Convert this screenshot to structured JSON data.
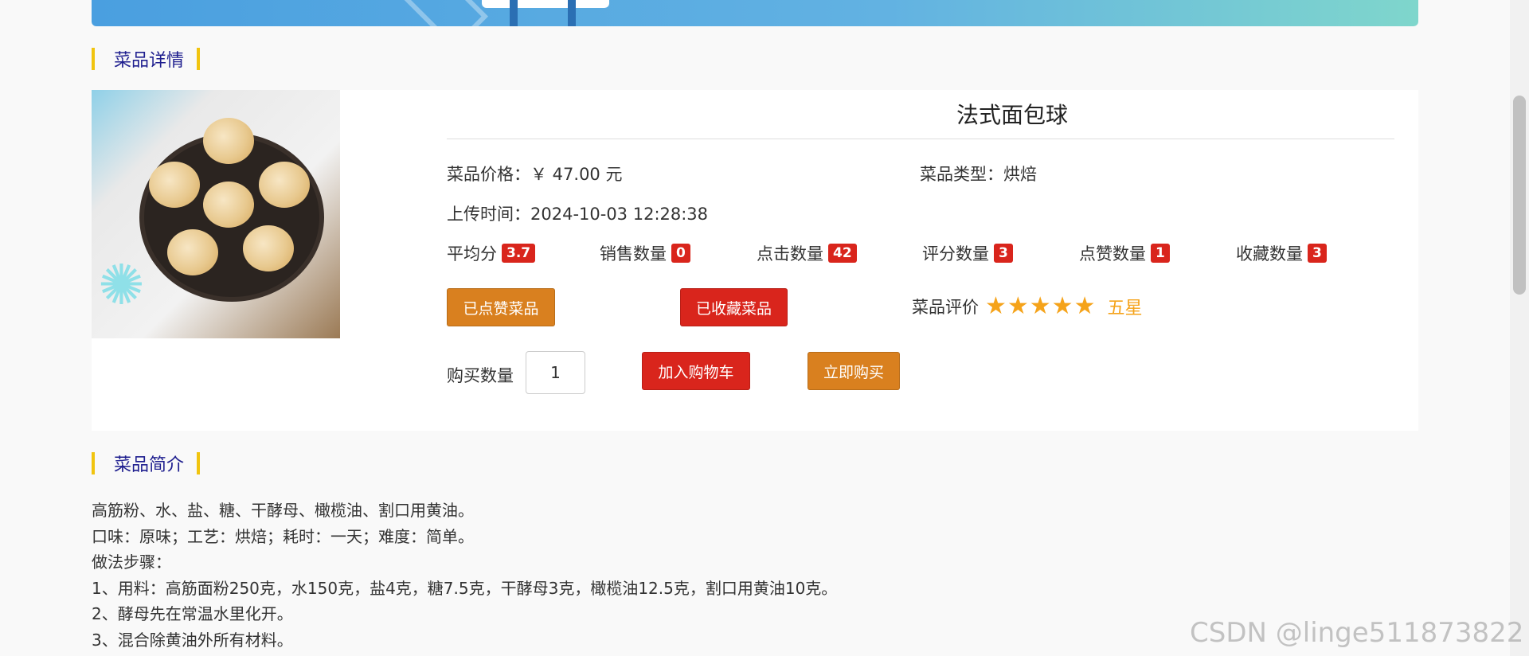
{
  "sections": {
    "detail_title": "菜品详情",
    "intro_title": "菜品简介"
  },
  "dish": {
    "name": "法式面包球",
    "price_label": "菜品价格：",
    "price_value": "￥ 47.00 元",
    "type_label": "菜品类型：",
    "type_value": "烘焙",
    "upload_label": "上传时间：",
    "upload_value": "2024-10-03 12:28:38"
  },
  "stats": [
    {
      "label": "平均分",
      "value": "3.7"
    },
    {
      "label": "销售数量",
      "value": "0"
    },
    {
      "label": "点击数量",
      "value": "42"
    },
    {
      "label": "评分数量",
      "value": "3"
    },
    {
      "label": "点赞数量",
      "value": "1"
    },
    {
      "label": "收藏数量",
      "value": "3"
    }
  ],
  "buttons": {
    "liked": "已点赞菜品",
    "favorited": "已收藏菜品",
    "add_cart": "加入购物车",
    "buy_now": "立即购买"
  },
  "rating": {
    "label": "菜品评价",
    "stars": "★★★★★",
    "text": "五星",
    "value": 5,
    "max": 5
  },
  "purchase": {
    "label": "购买数量",
    "quantity": "1"
  },
  "intro_lines": [
    "高筋粉、水、盐、糖、干酵母、橄榄油、割口用黄油。",
    "口味：原味；工艺：烘焙；耗时：一天；难度：简单。",
    "做法步骤：",
    "1、用料：高筋面粉250克，水150克，盐4克，糖7.5克，干酵母3克，橄榄油12.5克，割口用黄油10克。",
    "2、酵母先在常温水里化开。",
    "3、混合除黄油外所有材料。"
  ],
  "watermark": "CSDN @linge511873822",
  "colors": {
    "accent_red": "#d9251c",
    "accent_orange": "#d9801f",
    "star": "#f5a31a",
    "section_bar": "#f1c40f",
    "section_text": "#1f1f8f"
  }
}
